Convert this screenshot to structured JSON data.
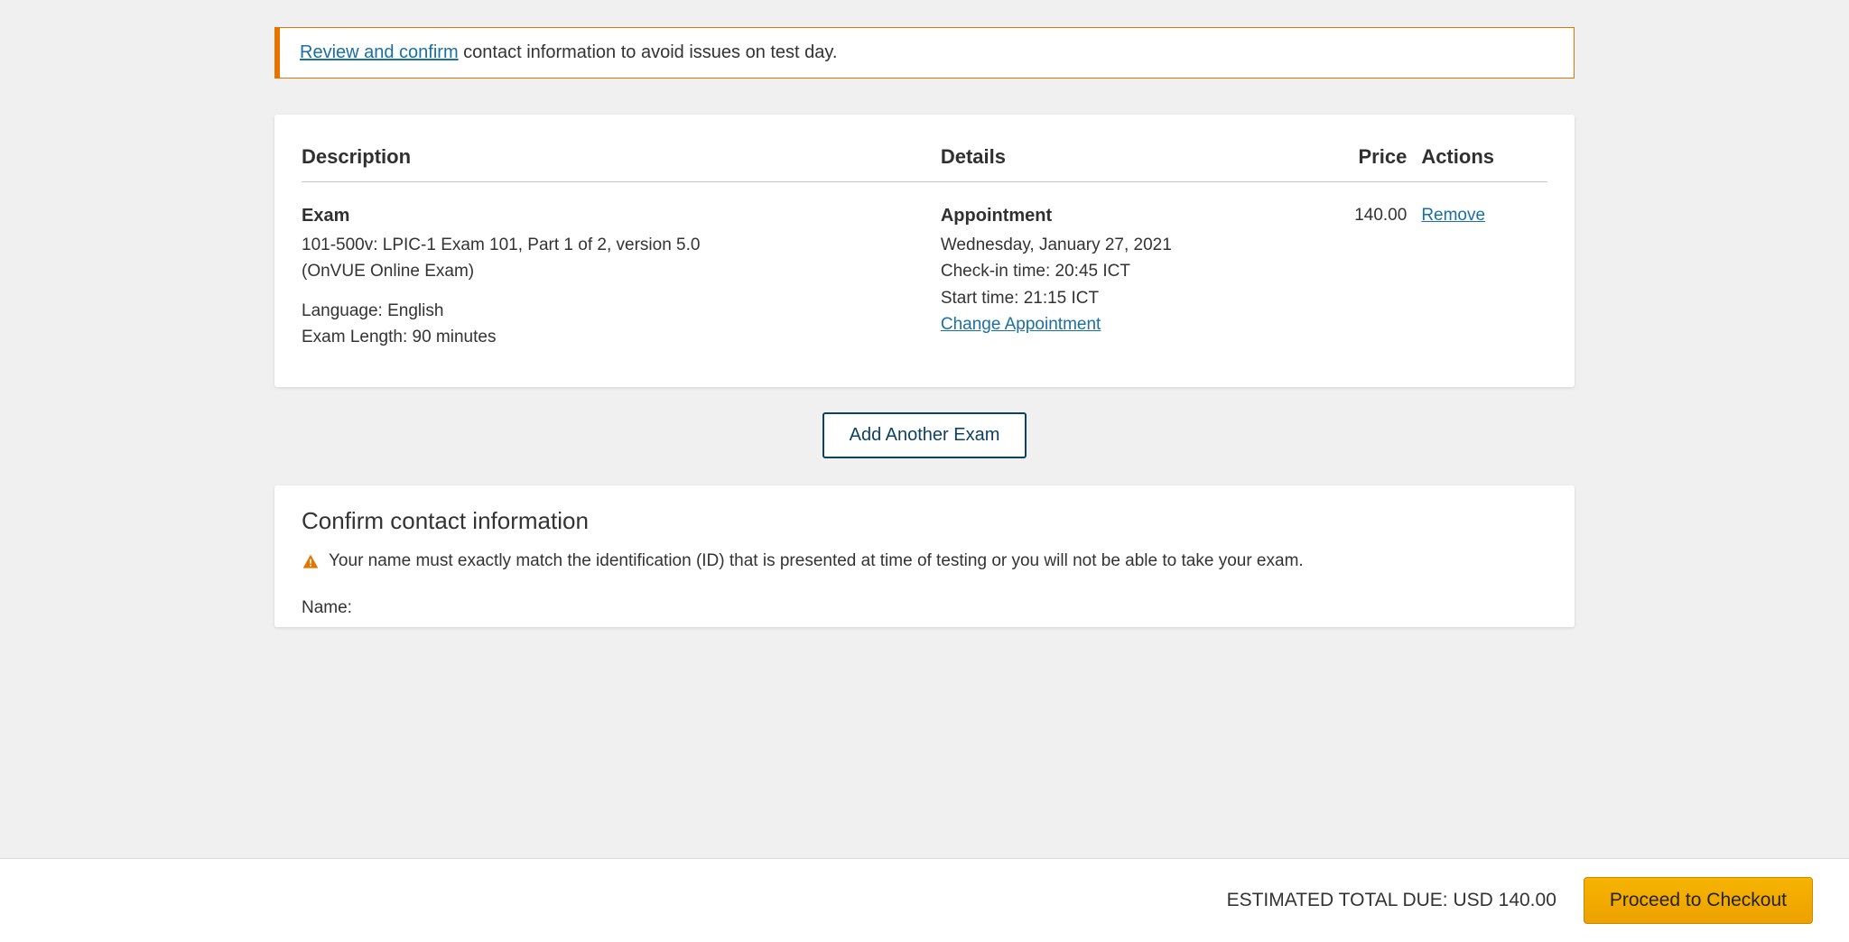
{
  "alert": {
    "link_text": "Review and confirm",
    "rest_text": " contact information to avoid issues on test day."
  },
  "table": {
    "headers": {
      "description": "Description",
      "details": "Details",
      "price": "Price",
      "actions": "Actions"
    },
    "row": {
      "exam_heading": "Exam",
      "line1": "101-500v: LPIC-1 Exam 101, Part 1 of 2, version 5.0",
      "line2": "(OnVUE Online Exam)",
      "language": "Language: English",
      "length": "Exam Length: 90 minutes",
      "appt_heading": "Appointment",
      "date": "Wednesday, January 27, 2021",
      "checkin": "Check-in time: 20:45 ICT",
      "start": "Start time: 21:15 ICT",
      "change_link": "Change Appointment",
      "price": "140.00",
      "remove_link": "Remove"
    }
  },
  "add_button": "Add Another Exam",
  "contact": {
    "title": "Confirm contact information",
    "warning": "Your name must exactly match the identification (ID) that is presented at time of testing or you will not be able to take your exam.",
    "name_label": "Name:"
  },
  "footer": {
    "total_label": "ESTIMATED TOTAL DUE: USD 140.00",
    "checkout_button": "Proceed to Checkout"
  }
}
